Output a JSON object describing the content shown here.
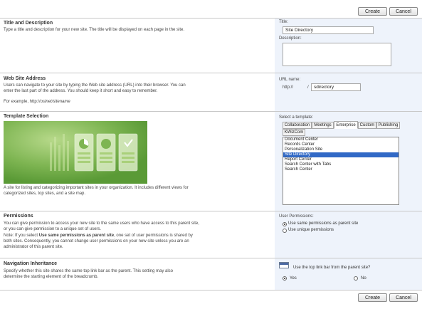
{
  "buttons": {
    "create": "Create",
    "cancel": "Cancel"
  },
  "title_section": {
    "heading": "Title and Description",
    "text": "Type a title and description for your new site. The title will be displayed on each page in the site.",
    "title_label": "Title:",
    "title_value": "Site Directory",
    "description_label": "Description:"
  },
  "address_section": {
    "heading": "Web Site Address",
    "text": "Users can navigate to your site by typing the Web site address (URL) into their browser. You can enter the last part of the address. You should keep it short and easy to remember.",
    "example": "For example, http://",
    "example_italic": "osinet/sitename",
    "url_label": "URL name:",
    "url_prefix": "http://",
    "url_slash": "/",
    "url_value": "sdirectory"
  },
  "template_section": {
    "heading": "Template Selection",
    "select_label": "Select a template:",
    "description": "A site for listing and categorizing important sites in your organization. It includes different views for categorized sites, top sites, and a site map.",
    "tabs": [
      "Collaboration",
      "Meetings",
      "Enterprise",
      "Custom",
      "Publishing",
      "KWizCom"
    ],
    "active_tab": "Enterprise",
    "templates": [
      "Document Center",
      "Records Center",
      "Personalization Site",
      "Site Directory",
      "Report Center",
      "Search Center with Tabs",
      "Search Center"
    ],
    "selected_template": "Site Directory"
  },
  "permissions_section": {
    "heading": "Permissions",
    "text1": "You can give permission to access your new site to the same users who have access to this parent site, or you can give permission to a unique set of users.",
    "note_prefix": "Note: If you select ",
    "note_bold": "Use same permissions as parent site",
    "note_suffix": ", one set of user permissions is shared by both sites. Consequently, you cannot change user permissions on your new site unless you are an administrator of this parent site.",
    "label": "User Permissions:",
    "option_same": "Use same permissions as parent site",
    "option_unique": "Use unique permissions",
    "selected": "same"
  },
  "navigation_section": {
    "heading": "Navigation Inheritance",
    "text": "Specify whether this site shares the same top link bar as the parent. This setting may also determine the starting element of the breadcrumb.",
    "question": "Use the top link bar from the parent site?",
    "yes": "Yes",
    "no": "No",
    "selected": "yes"
  },
  "colors": {
    "panel": "#eef3fb",
    "selection": "#3169c6",
    "template_green": "#6ba544"
  }
}
